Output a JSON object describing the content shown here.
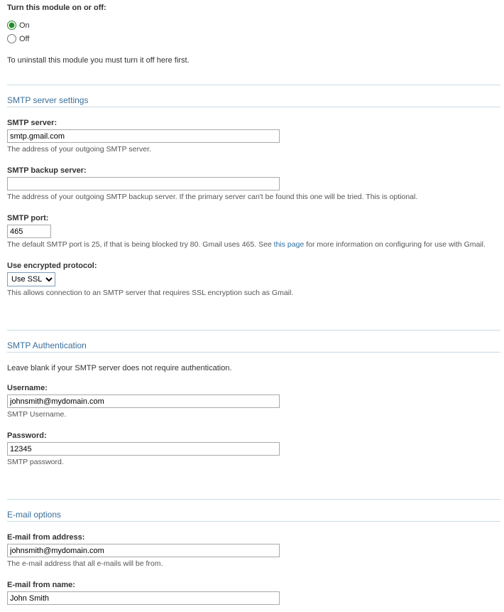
{
  "module_toggle": {
    "heading": "Turn this module on or off:",
    "on_label": "On",
    "off_label": "Off",
    "selected": "on",
    "uninstall_note": "To uninstall this module you must turn it off here first."
  },
  "smtp_settings": {
    "legend": "SMTP server settings",
    "server": {
      "label": "SMTP server:",
      "value": "smtp.gmail.com",
      "help": "The address of your outgoing SMTP server."
    },
    "backup_server": {
      "label": "SMTP backup server:",
      "value": "",
      "help": "The address of your outgoing SMTP backup server. If the primary server can't be found this one will be tried. This is optional."
    },
    "port": {
      "label": "SMTP port:",
      "value": "465",
      "help_pre": "The default SMTP port is 25, if that is being blocked try 80. Gmail uses 465. See ",
      "help_link": "this page",
      "help_post": " for more information on configuring for use with Gmail."
    },
    "encryption": {
      "label": "Use encrypted protocol:",
      "selected": "Use SSL",
      "help": "This allows connection to an SMTP server that requires SSL encryption such as Gmail."
    }
  },
  "smtp_auth": {
    "legend": "SMTP Authentication",
    "intro": "Leave blank if your SMTP server does not require authentication.",
    "username": {
      "label": "Username:",
      "value": "johnsmith@mydomain.com",
      "help": "SMTP Username."
    },
    "password": {
      "label": "Password:",
      "value": "12345",
      "help": "SMTP password."
    }
  },
  "email_options": {
    "legend": "E-mail options",
    "from_address": {
      "label": "E-mail from address:",
      "value": "johnsmith@mydomain.com",
      "help": "The e-mail address that all e-mails will be from."
    },
    "from_name": {
      "label": "E-mail from name:",
      "value": "John Smith"
    }
  }
}
